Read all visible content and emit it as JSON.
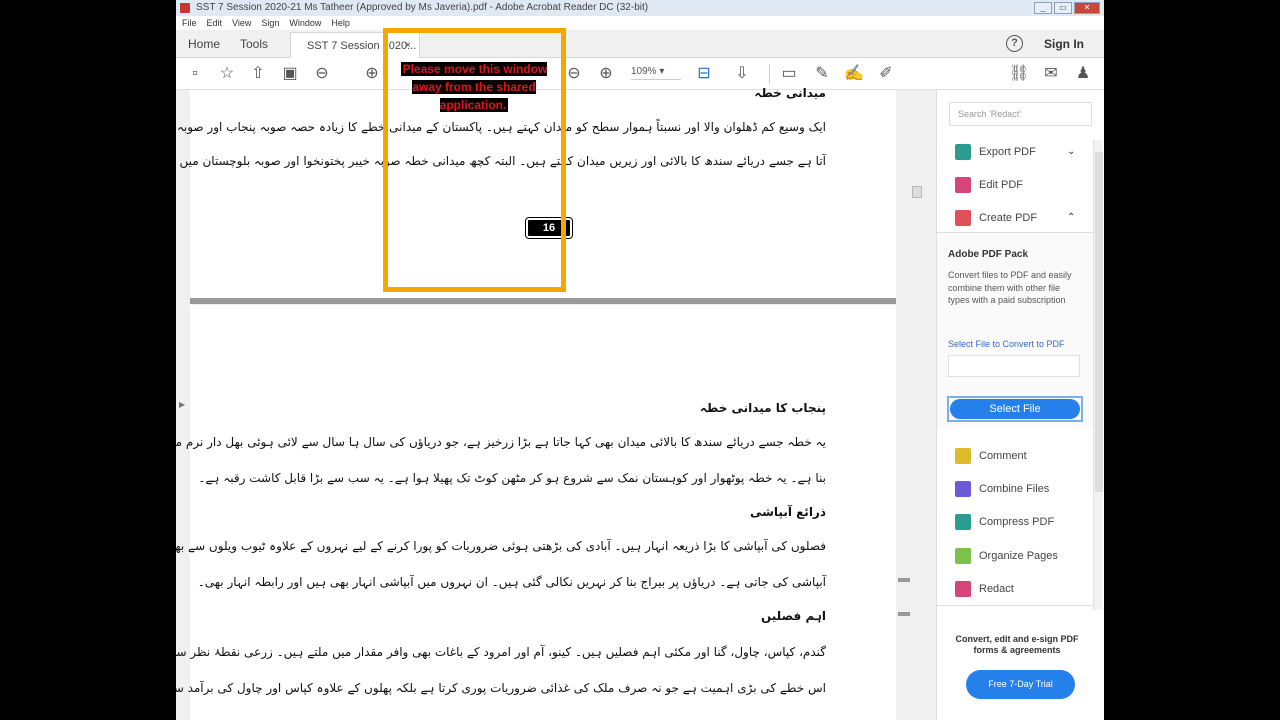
{
  "window": {
    "title": "SST 7 Session 2020-21 Ms Tatheer (Approved by Ms Javeria).pdf - Adobe Acrobat Reader DC (32-bit)",
    "controls": [
      "_",
      "▭",
      "✕"
    ]
  },
  "menu": [
    "File",
    "Edit",
    "View",
    "Sign",
    "Window",
    "Help"
  ],
  "tabs": {
    "home": "Home",
    "tools": "Tools",
    "document": "SST 7 Session 2020...",
    "close": "×",
    "help": "?",
    "sign_in": "Sign In"
  },
  "toolbar": {
    "zoom": "109%"
  },
  "page1": {
    "heading": "میدانی خطہ",
    "lines": [
      "ایک وسیع کم ڈھلوان والا اور نسبتاً ہموار سطح کو میدان کہتے ہیں۔ پاکستان کے میدانی خطے کا زیادہ حصہ صوبہ پنجاب اور صوبہ سندھ میں",
      "آتا ہے جسے دریائے سندھ کا بالائی اور زیریں میدان کہتے ہیں۔ البتہ کچھ میدانی خطہ صوبہ خیبر پختونخوا اور صوبہ بلوچستان میں بھی آتا ہے۔"
    ],
    "page_number": "16"
  },
  "page2": {
    "sections": [
      {
        "heading": "پنجاب کا میدانی خطہ",
        "lines": [
          "یہ خطہ جسے دریائے سندھ کا بالائی میدان بھی کہا جاتا ہے بڑا زرخیز ہے، جو دریاؤں کی سال ہا سال سے لائی ہوئی بھل دار نرم مٹی سے",
          "بنا ہے۔ یہ خطہ پوٹھوار اور کوہستان نمک سے شروع ہو کر مٹھن کوٹ تک پھیلا ہوا ہے۔ یہ سب سے بڑا قابل کاشت رقبہ ہے۔"
        ]
      },
      {
        "heading": "ذرائع آبپاشی",
        "lines": [
          "فصلوں کی آبپاشی کا بڑا ذریعہ انہار ہیں۔ آبادی کی بڑھتی ہوئی ضروریات کو پورا کرنے کے لیے نہروں کے علاوہ ٹیوب ویلوں سے بھی",
          "آبپاشی کی جاتی ہے۔ دریاؤں پر بیراج بنا کر نہریں نکالی گئی ہیں۔ ان نہروں میں آبپاشی انہار بھی ہیں اور رابطہ انہار بھی۔"
        ]
      },
      {
        "heading": "اہم فصلیں",
        "lines": [
          "گندم، کپاس، چاول، گنا اور مکئی اہم فصلیں ہیں۔ کینو، آم اور امرود کے باغات بھی وافر مقدار میں ملتے ہیں۔ زرعی نقطۂ نظر سے",
          "اس خطے کی بڑی اہمیت ہے جو نہ صرف ملک کی غذائی ضروریات پوری کرتا ہے بلکہ پھلوں کے علاوہ کپاس اور چاول کی برآمد سے کثیر زرمبادلہ"
        ]
      }
    ]
  },
  "right_pane": {
    "search_placeholder": "Search 'Redact'",
    "tools_top": [
      {
        "label": "Export PDF",
        "color": "#2a9d8f",
        "chevron": "⌄"
      },
      {
        "label": "Edit PDF",
        "color": "#d6457a"
      },
      {
        "label": "Create PDF",
        "color": "#e0505a",
        "chevron": "⌃"
      }
    ],
    "pack": {
      "title": "Adobe PDF Pack",
      "description": "Convert files to PDF and easily combine them with other file types with a paid subscription",
      "select_label": "Select File to Convert to PDF",
      "button": "Select File"
    },
    "tools_bottom": [
      {
        "label": "Comment",
        "color": "#e0b92a"
      },
      {
        "label": "Combine Files",
        "color": "#6b5bd6"
      },
      {
        "label": "Compress PDF",
        "color": "#2a9d8f"
      },
      {
        "label": "Organize Pages",
        "color": "#7cc24a"
      },
      {
        "label": "Redact",
        "color": "#d6457a"
      }
    ],
    "promo": "Convert, edit and e-sign PDF forms & agreements",
    "trial": "Free 7-Day Trial"
  },
  "overlay": {
    "message": "Please move this window away from the shared application.",
    "color": "#f7a600"
  }
}
